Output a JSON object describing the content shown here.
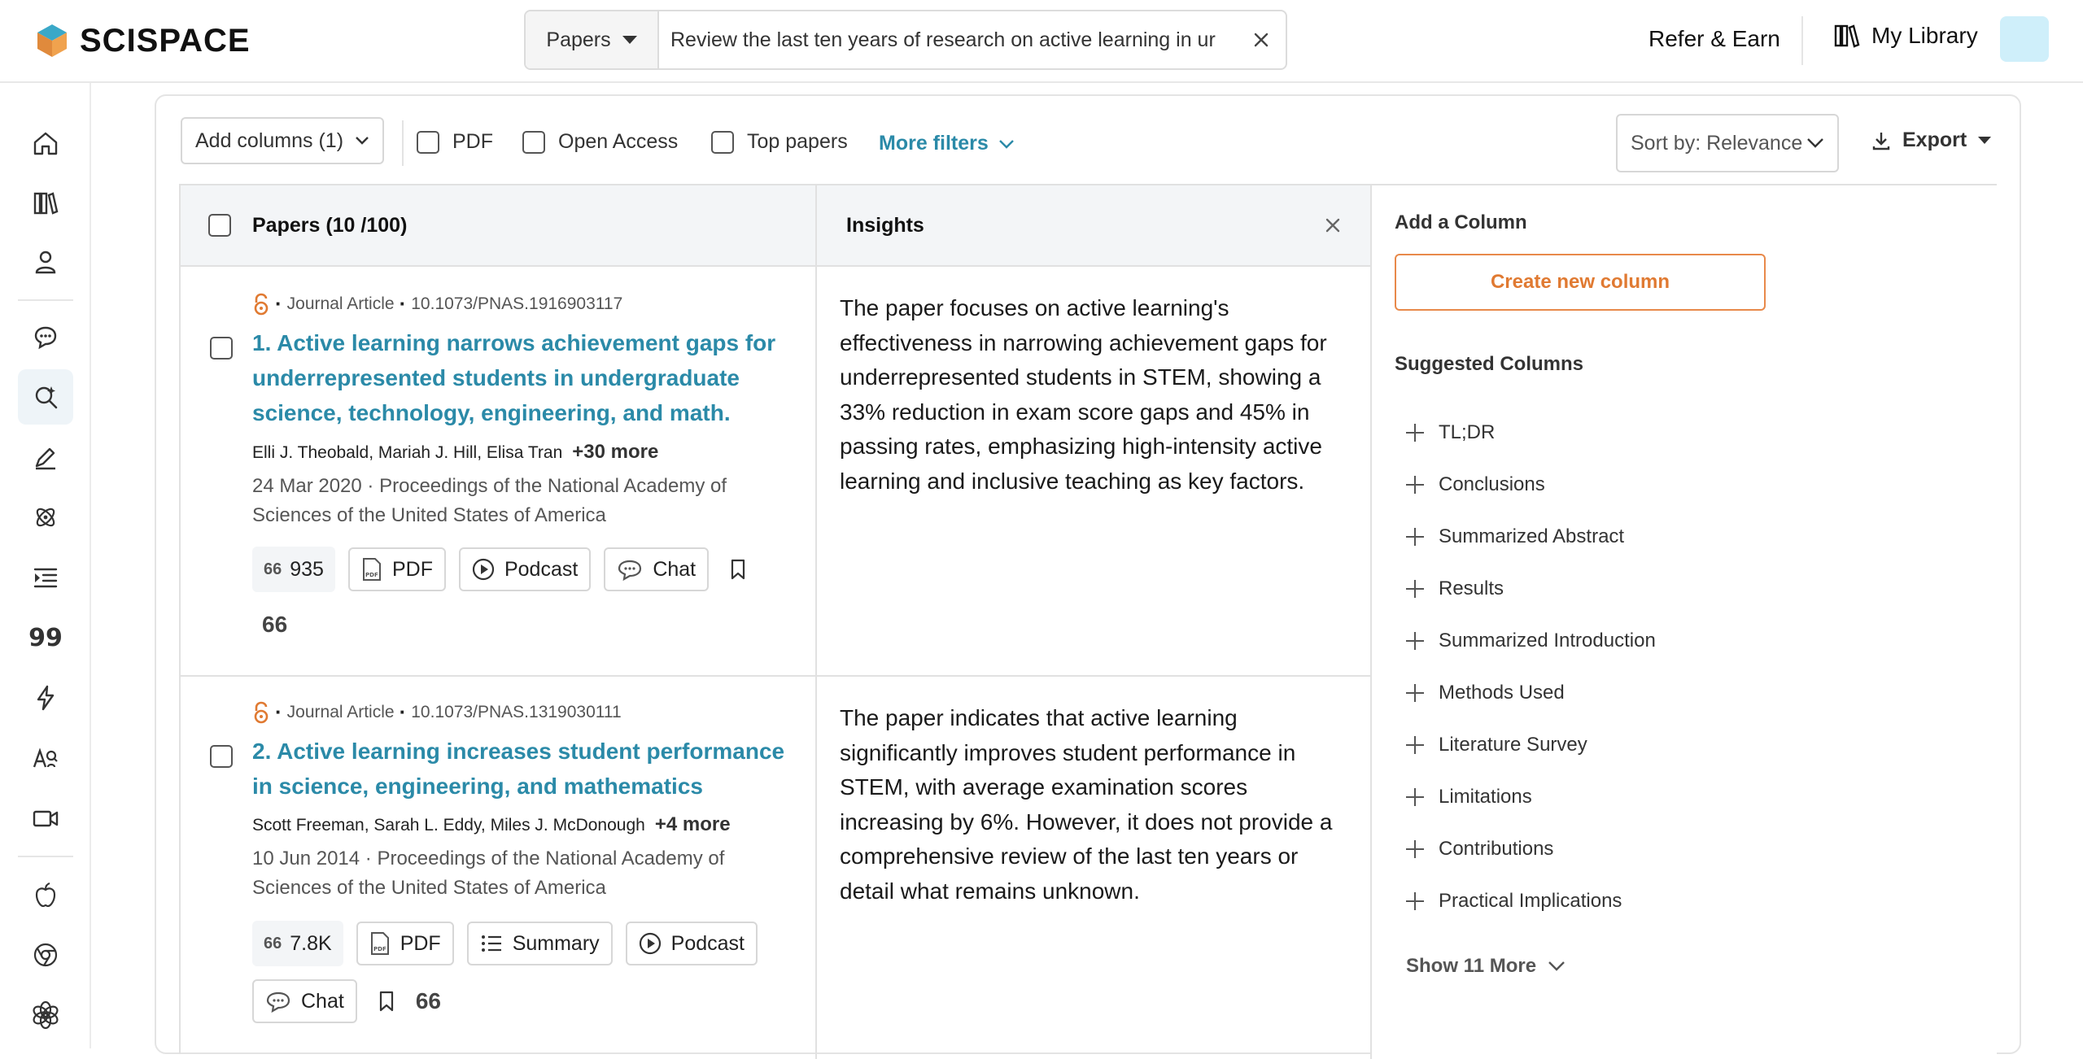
{
  "header": {
    "brand": "SCISPACE",
    "search_type": "Papers",
    "search_query": "Review the last ten years of research on active learning in ur",
    "refer_label": "Refer & Earn",
    "library_label": "My Library"
  },
  "sidebar": {
    "icons": [
      "home-icon",
      "library-icon",
      "user-icon",
      "chat-icon",
      "search-papers-icon",
      "pen-icon",
      "atom-icon",
      "list-icon",
      "quote-icon",
      "bolt-icon",
      "ai-detector-icon",
      "video-icon",
      "apple-icon",
      "chrome-icon",
      "openai-icon"
    ]
  },
  "filters": {
    "add_columns": "Add columns (1)",
    "pdf": "PDF",
    "open_access": "Open Access",
    "top_papers": "Top papers",
    "more_filters": "More filters",
    "sort": "Sort by: Relevance",
    "export": "Export"
  },
  "table": {
    "papers_header": "Papers (10 /100)",
    "insights_header": "Insights",
    "rows": [
      {
        "type": "Journal Article",
        "doi": "10.1073/PNAS.1916903117",
        "title": "1. Active learning narrows achievement gaps for underrepresented students in undergraduate science, technology, engineering, and math.",
        "authors": "Elli J. Theobald, Mariah J. Hill, Elisa Tran",
        "more_authors": "+30 more",
        "date": "24 Mar 2020",
        "venue": "Proceedings of the National Academy of Sciences of the United States of America",
        "citations": "935",
        "pdf": "PDF",
        "podcast": "Podcast",
        "chat": "Chat",
        "quote": "66",
        "insight": "The paper focuses on active learning's effectiveness in narrowing achievement gaps for underrepresented students in STEM, showing a 33% reduction in exam score gaps and 45% in passing rates, emphasizing high-intensity active learning and inclusive teaching as key factors."
      },
      {
        "type": "Journal Article",
        "doi": "10.1073/PNAS.1319030111",
        "title": "2. Active learning increases student performance in science, engineering, and mathematics",
        "authors": "Scott Freeman, Sarah L. Eddy, Miles J. McDonough",
        "more_authors": "+4 more",
        "date": "10 Jun 2014",
        "venue": "Proceedings of the National Academy of Sciences of the United States of America",
        "citations": "7.8K",
        "pdf": "PDF",
        "summary": "Summary",
        "podcast": "Podcast",
        "chat": "Chat",
        "quote": "66",
        "insight": "The paper indicates that active learning significantly improves student performance in STEM, with average examination scores increasing by 6%. However, it does not provide a comprehensive review of the last ten years or detail what remains unknown."
      }
    ]
  },
  "right_panel": {
    "add_column_heading": "Add a Column",
    "create_button": "Create new column",
    "suggested_heading": "Suggested Columns",
    "suggested": [
      "TL;DR",
      "Conclusions",
      "Summarized Abstract",
      "Results",
      "Summarized Introduction",
      "Methods Used",
      "Literature Survey",
      "Limitations",
      "Contributions",
      "Practical Implications"
    ],
    "show_more": "Show 11 More"
  },
  "colors": {
    "accent": "#2b8aa8",
    "orange": "#e07a32",
    "avatar": "#cfeffa"
  }
}
